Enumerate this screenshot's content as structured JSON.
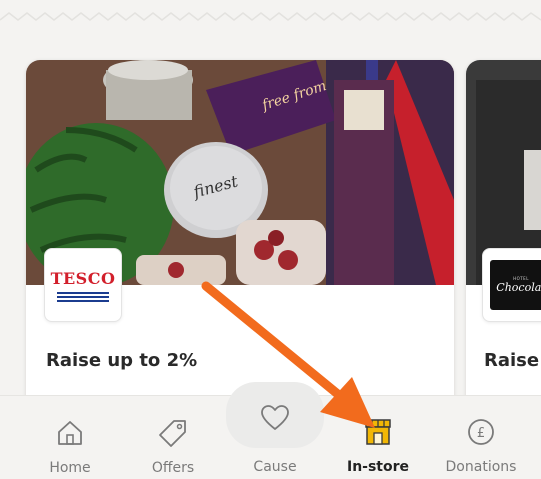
{
  "colors": {
    "background": "#f4f3f1",
    "accent_arrow": "#f26b1d",
    "instore_icon": "#f2b705",
    "tesco_red": "#d21f2b",
    "tesco_blue": "#1b3c8f",
    "text_dark": "#2a2a2a",
    "text_muted": "#7a7a7a"
  },
  "offers": [
    {
      "brand": "TESCO",
      "logo_icon": "tesco-logo",
      "image_subject": "grocery-basket-photo",
      "title": "Raise up to 2%"
    },
    {
      "brand": "Chocolat",
      "brand_small": "HOTEL",
      "logo_icon": "hotel-chocolat-logo",
      "title": "Raise"
    }
  ],
  "nav": {
    "items": [
      {
        "label": "Home",
        "icon": "home-icon",
        "active": false
      },
      {
        "label": "Offers",
        "icon": "tag-icon",
        "active": false
      },
      {
        "label": "Cause",
        "icon": "heart-icon",
        "active": false
      },
      {
        "label": "In-store",
        "icon": "storefront-icon",
        "active": true
      },
      {
        "label": "Donations",
        "icon": "pound-coin-icon",
        "active": false
      }
    ]
  }
}
